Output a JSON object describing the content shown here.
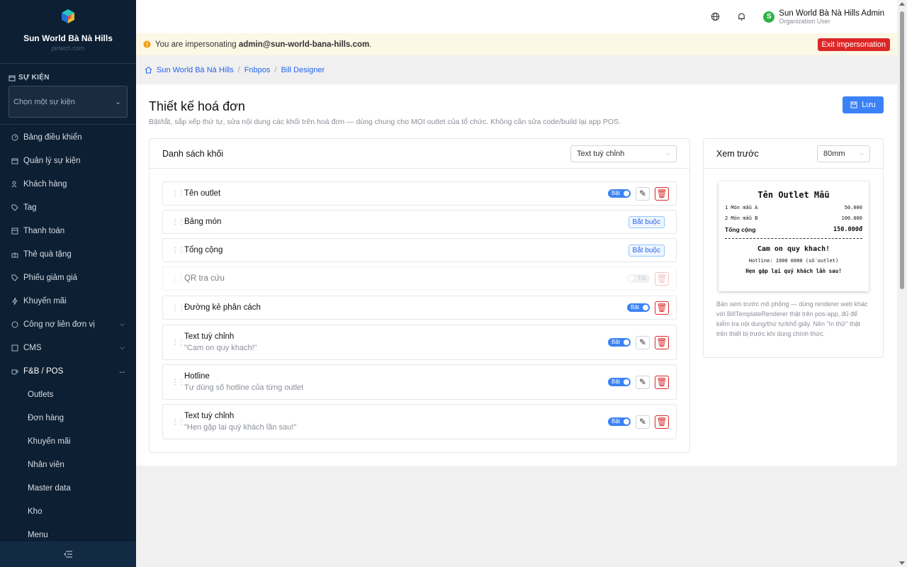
{
  "sidebar": {
    "org_name": "Sun World Bà Nà Hills",
    "org_sub": "pirtech.com",
    "section_label": "SỰ KIỆN",
    "event_select_placeholder": "Chọn một sự kiện",
    "items": [
      {
        "label": "Bảng điều khiển",
        "icon": "dashboard-icon"
      },
      {
        "label": "Quản lý sự kiện",
        "icon": "calendar-icon"
      },
      {
        "label": "Khách hàng",
        "icon": "users-icon"
      },
      {
        "label": "Tag",
        "icon": "tag-icon"
      },
      {
        "label": "Thanh toán",
        "icon": "payment-icon"
      },
      {
        "label": "Thẻ quà tặng",
        "icon": "gift-icon"
      },
      {
        "label": "Phiếu giảm giá",
        "icon": "coupon-icon"
      },
      {
        "label": "Khuyến mãi",
        "icon": "lightning-icon"
      },
      {
        "label": "Công nợ liên đơn vị",
        "icon": "debt-icon"
      },
      {
        "label": "CMS",
        "icon": "cms-icon"
      },
      {
        "label": "F&B / POS",
        "icon": "coffee-icon"
      }
    ],
    "sub_items": [
      "Outlets",
      "Đơn hàng",
      "Khuyến mãi",
      "Nhân viên",
      "Master data",
      "Kho",
      "Menu"
    ]
  },
  "topbar": {
    "user_name": "Sun World Bà Nà Hills Admin",
    "user_role": "Organization User",
    "avatar_letter": "S"
  },
  "banner": {
    "prefix": "You are impersonating",
    "email": "admin@sun-world-bana-hills.com",
    "suffix": ".",
    "exit_label": "Exit impersonation"
  },
  "breadcrumb": [
    "Sun World Bà Nà Hills",
    "Fnbpos",
    "Bill Designer"
  ],
  "page": {
    "title": "Thiết kế hoá đơn",
    "description": "Bật/tắt, sắp xếp thứ tự, sửa nội dung các khối trên hoá đơn — dùng chung cho MỌI outlet của tổ chức. Không cần sửa code/build lại app POS.",
    "save_label": "Lưu"
  },
  "blocks_card": {
    "title": "Danh sách khối",
    "add_select": "Text tuỳ chỉnh",
    "on_label": "Bật",
    "off_label": "Tắt",
    "required_label": "Bắt buộc",
    "blocks": [
      {
        "name": "Tên outlet",
        "sub": "",
        "state": "on"
      },
      {
        "name": "Bảng món",
        "sub": "",
        "state": "required"
      },
      {
        "name": "Tổng cộng",
        "sub": "",
        "state": "required"
      },
      {
        "name": "QR tra cứu",
        "sub": "",
        "state": "off"
      },
      {
        "name": "Đường kẻ phân cách",
        "sub": "",
        "state": "on-noedit"
      },
      {
        "name": "Text tuỳ chỉnh",
        "sub": "\"Cam on quy khach!\"",
        "state": "on"
      },
      {
        "name": "Hotline",
        "sub": "Tự dùng số hotline của từng outlet",
        "state": "on"
      },
      {
        "name": "Text tuỳ chỉnh",
        "sub": "\"Hẹn gặp lại quý khách lần sau!\"",
        "state": "on"
      }
    ]
  },
  "preview_card": {
    "title": "Xem trước",
    "paper_select": "80mm",
    "receipt": {
      "outlet_name": "Tên Outlet Mẫu",
      "lines": [
        {
          "item": "1 Món mẫu A",
          "price": "50.000"
        },
        {
          "item": "2 Món mẫu B",
          "price": "100.000"
        }
      ],
      "total_label": "Tổng cộng",
      "total_value": "150.000đ",
      "thanks": "Cam on quy khach!",
      "hotline": "Hotline: 1900 0000 (số outlet)",
      "farewell": "Hẹn gặp lại quý khách lần sau!"
    },
    "note": "Bản xem trước mô phỏng — dùng renderer web khác với BillTemplateRenderer thật trên pos-app, đủ để kiểm tra nội dung/thứ tự/khổ giấy. Nên \"In thử\" thật trên thiết bị trước khi dùng chính thức."
  },
  "colors": {
    "sidebar_bg": "#0d1f33",
    "primary": "#3b82f6",
    "danger": "#dc2626",
    "banner_bg": "#fdf7e5",
    "avatar": "#2fb344"
  }
}
